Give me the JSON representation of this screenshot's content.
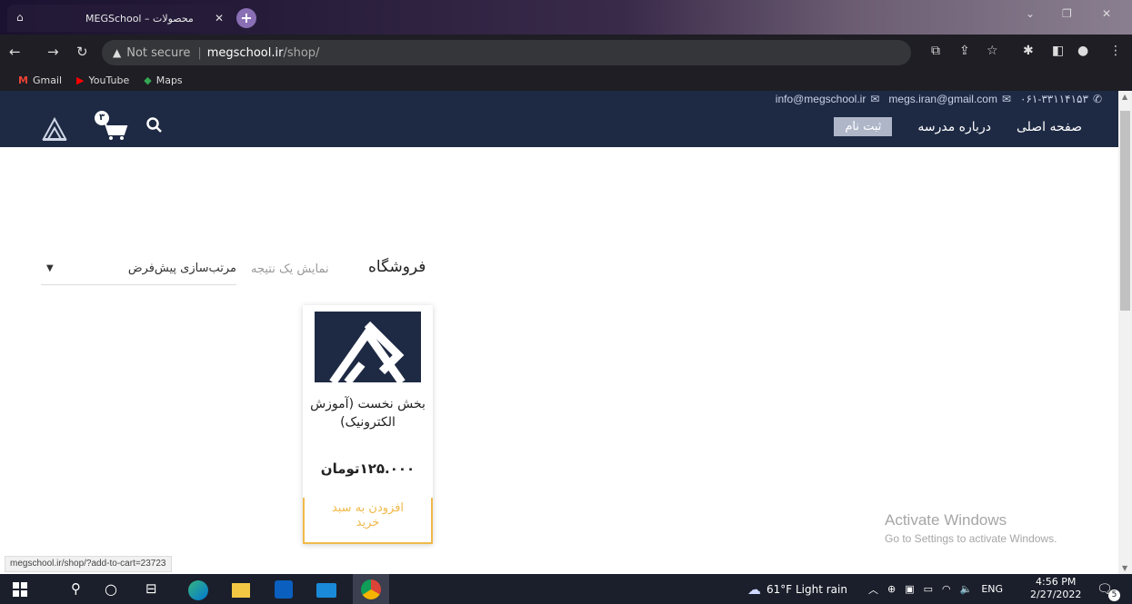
{
  "browser": {
    "tab_title": "MEGSchool – محصولات",
    "url_warning": "Not secure",
    "url_host": "megschool.ir",
    "url_path": "/shop/",
    "bookmarks": [
      {
        "label": "Gmail",
        "icon": "gmail-icon",
        "color": "#ea4335"
      },
      {
        "label": "YouTube",
        "icon": "youtube-icon",
        "color": "#ff0000"
      },
      {
        "label": "Maps",
        "icon": "maps-icon",
        "color": "#34a853"
      }
    ]
  },
  "site": {
    "contact": {
      "phone": "۰۶۱-۳۳۱۱۴۱۵۳",
      "email_1": "megs.iran@gmail.com",
      "email_2": "info@megschool.ir"
    },
    "nav": {
      "home": "صفحه اصلی",
      "about": "درباره مدرسه",
      "register": "ثبت نام"
    },
    "cart_count": "۳",
    "brand_color": "#1e2a44",
    "accent_color": "#f0b94a"
  },
  "shop": {
    "title": "فروشگاه",
    "result_count": "نمایش یک نتیجه",
    "sort_label": "مرتب‌سازی پیش‌فرض",
    "products": [
      {
        "title": "بخش نخست (آموزش الکترونیک)",
        "price": "۱۲۵.۰۰۰تومان",
        "button": "افزودن به سبد خرید"
      }
    ]
  },
  "status_url": "megschool.ir/shop/?add-to-cart=23723",
  "windows": {
    "activate_title": "Activate Windows",
    "activate_sub": "Go to Settings to activate Windows."
  },
  "taskbar": {
    "weather": "61°F  Light rain",
    "lang": "ENG",
    "time": "4:56 PM",
    "date": "2/27/2022",
    "notifications": "5"
  }
}
